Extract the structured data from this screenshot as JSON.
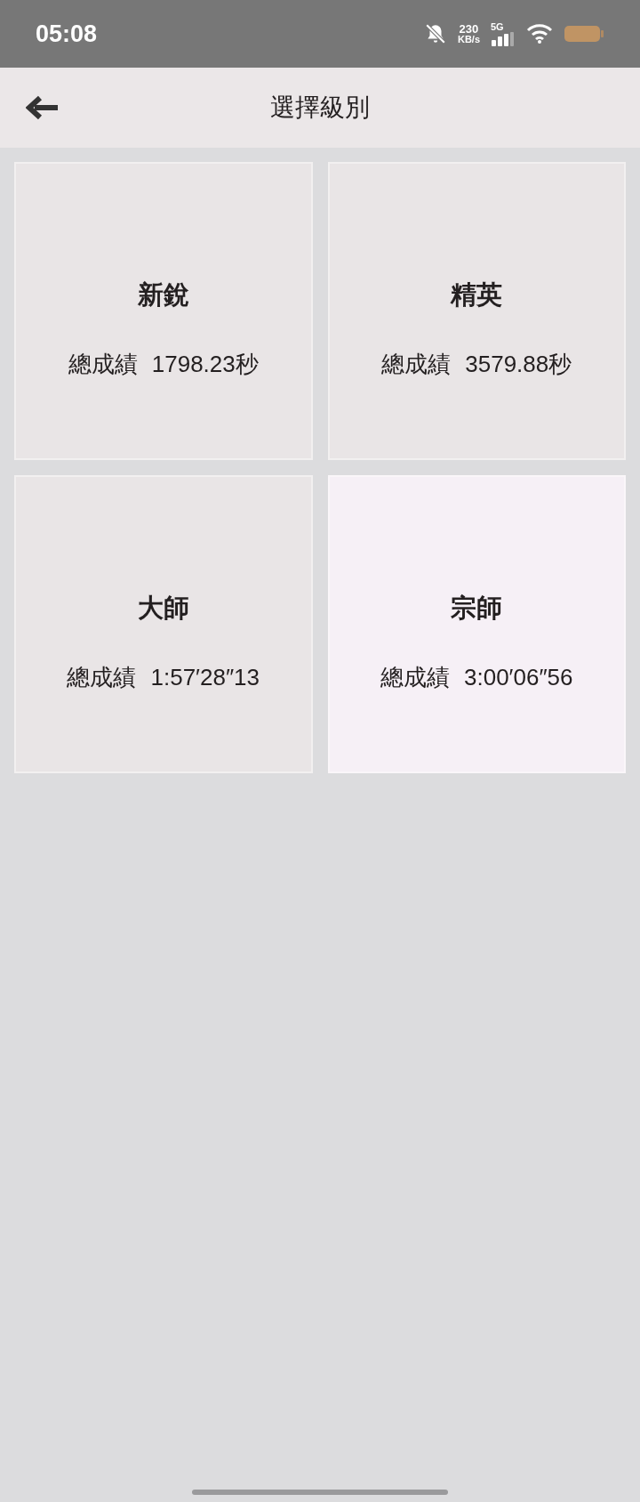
{
  "status_bar": {
    "time": "05:08",
    "speed": "230",
    "speed_unit": "KB/s",
    "network": "5G"
  },
  "header": {
    "title": "選擇級別"
  },
  "levels": [
    {
      "name": "新銳",
      "score_label": "總成績",
      "score": "1798.23秒",
      "selected": false
    },
    {
      "name": "精英",
      "score_label": "總成績",
      "score": "3579.88秒",
      "selected": false
    },
    {
      "name": "大師",
      "score_label": "總成績",
      "score": "1:57′28″13",
      "selected": false
    },
    {
      "name": "宗師",
      "score_label": "總成績",
      "score": "3:00′06″56",
      "selected": true
    }
  ]
}
